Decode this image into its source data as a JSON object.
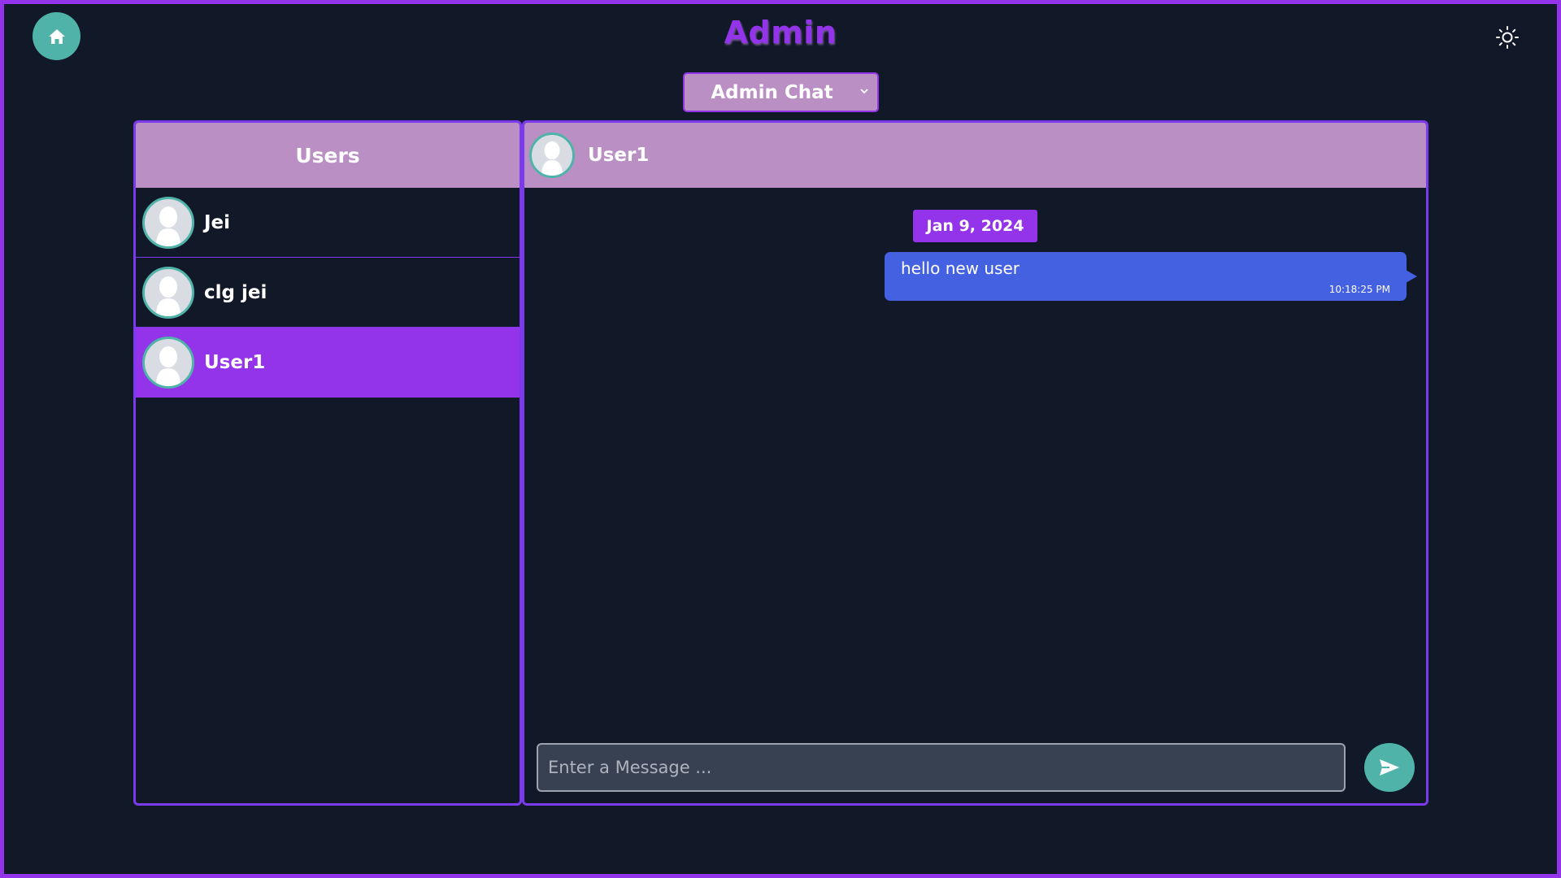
{
  "app": {
    "title": "Admin"
  },
  "toolbar": {
    "home_icon": "home-icon",
    "theme_icon": "sun-icon"
  },
  "mode_select": {
    "selected": "Admin Chat"
  },
  "users_panel": {
    "header": "Users",
    "users": [
      {
        "name": "Jei",
        "active": false
      },
      {
        "name": "clg jei",
        "active": false
      },
      {
        "name": "User1",
        "active": true
      }
    ]
  },
  "chat": {
    "user_name": "User1",
    "date": "Jan 9, 2024",
    "messages": [
      {
        "text": "hello new user",
        "time": "10:18:25 PM"
      }
    ],
    "input_placeholder": "Enter a Message ...",
    "send_icon": "send-icon"
  },
  "colors": {
    "background": "#111827",
    "accent": "#9333ea",
    "header_bg": "#b98fc4",
    "teal": "#4fb3a9",
    "bubble": "#4361e0"
  }
}
